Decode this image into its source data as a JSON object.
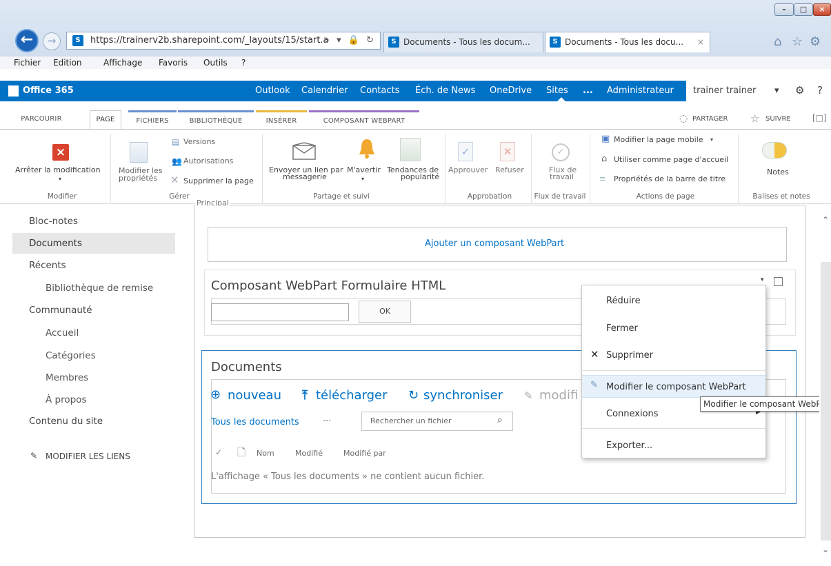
{
  "browser": {
    "url": "https://trainerv2b.sharepoint.com/_layouts/15/start.a",
    "url_host": "trainerv2b.sharepoint.com",
    "tabs": [
      {
        "label": "Documents - Tous les docum...",
        "active": false
      },
      {
        "label": "Documents - Tous les docu...",
        "active": true
      }
    ],
    "address_icons": "⌕ ▾ 🔒 ↻",
    "tab_close": "×",
    "toolbar_icons": [
      "home-icon",
      "star-icon",
      "gear-icon"
    ],
    "menu": [
      "Fichier",
      "Edition",
      "Affichage",
      "Favoris",
      "Outils",
      "?"
    ]
  },
  "suite": {
    "brand": "Office 365",
    "links": [
      "Outlook",
      "Calendrier",
      "Contacts",
      "Éch. de News",
      "OneDrive",
      "Sites",
      "...",
      "Administrateur"
    ],
    "user": "trainer trainer",
    "user_caret": "▾",
    "settings_icon": "⚙",
    "help_icon": "?",
    "colors": {
      "suite_blue": "#0072c6",
      "link_blue": "#0072c6",
      "stop_red": "#d9432e"
    }
  },
  "ribbon_tabs": [
    "PARCOURIR",
    "PAGE",
    "FICHIERS",
    "BIBLIOTHÈQUE",
    "INSÉRER",
    "COMPOSANT WEBPART"
  ],
  "ribbon_right": {
    "share": "PARTAGER",
    "follow": "SUIVRE",
    "focus_icon": "[□]"
  },
  "ribbon": {
    "stop_edit": "Arrêter la modification",
    "modify_props": [
      "Modifier les",
      "propriétés"
    ],
    "versions": "Versions",
    "permissions": "Autorisations",
    "delete_page": "Supprimer la page",
    "send_link": [
      "Envoyer un lien par",
      "messagerie"
    ],
    "alert_me": "M'avertir",
    "popularity": [
      "Tendances de",
      "popularité"
    ],
    "approve": "Approuver",
    "reject": "Refuser",
    "workflow": [
      "Flux de",
      "travail"
    ],
    "mobile_page": "Modifier la page mobile",
    "homepage": "Utiliser comme page d'accueil",
    "title_bar": "Propriétés de la barre de titre",
    "notes": "Notes",
    "groups": [
      "Modifier",
      "Gérer",
      "Partage et suivi",
      "Approbation",
      "Flux de travail",
      "Actions de page",
      "Balises et notes"
    ]
  },
  "leftnav": {
    "items": [
      "Bloc-notes",
      "Documents",
      "Récents",
      "Bibliothèque de remise",
      "Communauté",
      "Accueil",
      "Catégories",
      "Membres",
      "À propos",
      "Contenu du site"
    ],
    "edit_links": "MODIFIER LES LIENS"
  },
  "main": {
    "zone_label": "Principal",
    "add_webpart": "Ajouter un composant WebPart",
    "html_form_title": "Composant WebPart Formulaire HTML",
    "ok_label": "OK",
    "doc_title": "Documents",
    "doc_actions": [
      "nouveau",
      "télécharger",
      "synchroniser",
      "modifi"
    ],
    "view_name": "Tous les documents",
    "view_more": "···",
    "search_placeholder": "Rechercher un fichier",
    "columns": [
      "Nom",
      "Modifié",
      "Modifié par"
    ],
    "empty_message": "L'affichage « Tous les documents » ne contient aucun fichier."
  },
  "context_menu": {
    "items": [
      "Réduire",
      "Fermer",
      "Supprimer",
      "Modifier le composant WebPart",
      "Connexions",
      "Exporter..."
    ],
    "tooltip": "Modifier le composant WebPart"
  }
}
